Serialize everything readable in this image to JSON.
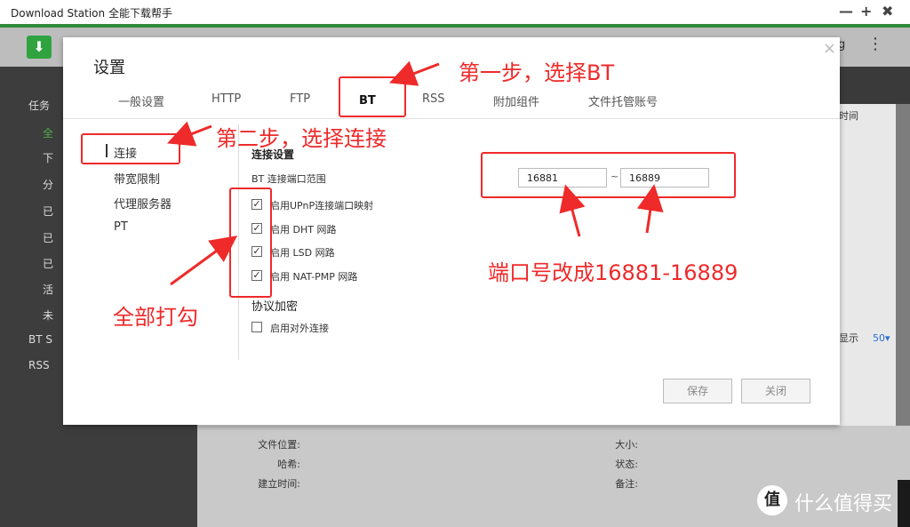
{
  "window": {
    "title": "Download Station 全能下载帮手",
    "minimize": "—",
    "maximize": "+",
    "close": "✖"
  },
  "background": {
    "sidebar": [
      "任务",
      "全",
      "下",
      "分",
      "已",
      "已",
      "已",
      "活",
      "未"
    ],
    "sidebar_bt": "BT S",
    "sidebar_rss": "RSS",
    "col_header": "时间",
    "page_size_label": "显示",
    "page_size_value": "50▾",
    "toolbar_text": "g",
    "details_left": [
      "文件位置:",
      "哈希:",
      "建立时间:"
    ],
    "details_right": [
      "大小:",
      "状态:",
      "备注:"
    ]
  },
  "dialog": {
    "title": "设置",
    "close": "×",
    "tabs": [
      "一般设置",
      "HTTP",
      "FTP",
      "BT",
      "RSS",
      "附加组件",
      "文件托管账号"
    ],
    "active_tab": "BT",
    "nav": [
      "连接",
      "带宽限制",
      "代理服务器",
      "PT"
    ],
    "connection": {
      "section_title": "连接设置",
      "port_range_label": "BT 连接端口范围",
      "port_from": "16881",
      "port_to": "16889",
      "tilde": "~",
      "options": [
        {
          "label": "启用UPnP连接端口映射",
          "checked": true
        },
        {
          "label": "启用 DHT 网路",
          "checked": true
        },
        {
          "label": "启用 LSD 网路",
          "checked": true
        },
        {
          "label": "启用 NAT-PMP 网路",
          "checked": true
        }
      ]
    },
    "encryption": {
      "section_title": "协议加密",
      "option_label": "启用对外连接",
      "checked": false
    },
    "buttons": {
      "save": "保存",
      "close": "关闭"
    }
  },
  "annotations": {
    "step1": "第一步，选择BT",
    "step2": "第二步，选择连接",
    "check_all": "全部打勾",
    "port_note": "端口号改成16881-16889",
    "color": "#ef2a2a"
  },
  "watermark": {
    "logo": "值",
    "text": "什么值得买"
  }
}
